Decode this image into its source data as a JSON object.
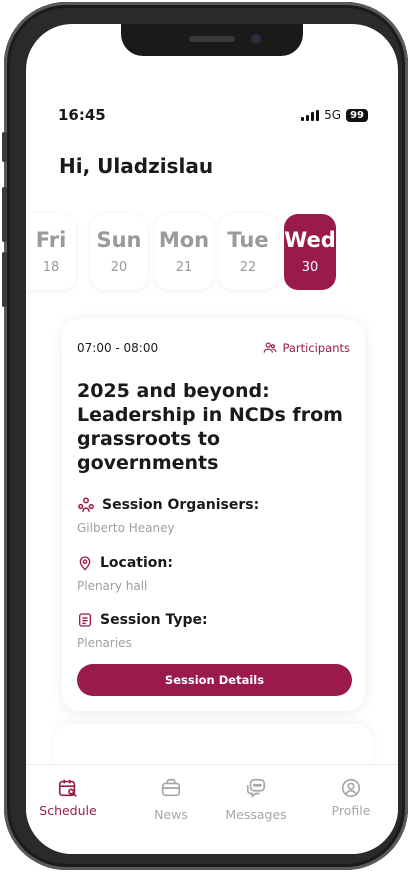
{
  "status_bar": {
    "time": "16:45",
    "network": "5G",
    "battery": "99"
  },
  "greeting": "Hi, Uladzislau",
  "days": [
    {
      "name": "Fri",
      "date": "18",
      "selected": false
    },
    {
      "name": "Sun",
      "date": "20",
      "selected": false
    },
    {
      "name": "Mon",
      "date": "21",
      "selected": false
    },
    {
      "name": "Tue",
      "date": "22",
      "selected": false
    },
    {
      "name": "Wed",
      "date": "30",
      "selected": true
    }
  ],
  "session": {
    "time_range": "07:00 - 08:00",
    "participants_label": "Participants",
    "title": "2025 and beyond: Leadership in NCDs from grassroots to governments",
    "organisers_label": "Session Organisers:",
    "organisers_value": "Gilberto Heaney",
    "location_label": "Location:",
    "location_value": "Plenary hall",
    "type_label": "Session Type:",
    "type_value": "Plenaries",
    "details_button": "Session Details"
  },
  "tabs": [
    {
      "label": "Schedule",
      "icon": "calendar-search-icon",
      "active": true
    },
    {
      "label": "News",
      "icon": "news-icon",
      "active": false
    },
    {
      "label": "Messages",
      "icon": "messages-icon",
      "active": false
    },
    {
      "label": "Profile",
      "icon": "profile-icon",
      "active": false
    }
  ],
  "colors": {
    "accent": "#9a1a4a",
    "muted": "#a6a6a6"
  }
}
